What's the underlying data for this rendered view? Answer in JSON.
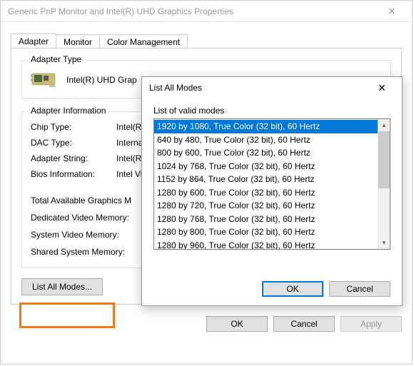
{
  "window": {
    "title": "Generic PnP Monitor and Intel(R) UHD Graphics Properties",
    "tabs": [
      "Adapter",
      "Monitor",
      "Color Management"
    ],
    "active_tab": 0
  },
  "adapter_type": {
    "group_label": "Adapter Type",
    "value": "Intel(R) UHD Grap"
  },
  "adapter_info": {
    "group_label": "Adapter Information",
    "rows": [
      {
        "label": "Chip Type:",
        "value": "Intel(R)"
      },
      {
        "label": "DAC Type:",
        "value": "Internal"
      },
      {
        "label": "Adapter String:",
        "value": "Intel(R)"
      },
      {
        "label": "Bios Information:",
        "value": "Intel Vid"
      }
    ],
    "totals": [
      {
        "label": "Total Available Graphics M"
      },
      {
        "label": "Dedicated Video Memory:"
      },
      {
        "label": "System Video Memory:"
      },
      {
        "label": "Shared System Memory:"
      }
    ]
  },
  "buttons": {
    "list_all_modes": "List All Modes...",
    "ok": "OK",
    "cancel": "Cancel",
    "apply": "Apply"
  },
  "dialog": {
    "title": "List All Modes",
    "list_label": "List of valid modes",
    "modes": [
      "1920 by 1080, True Color (32 bit), 60 Hertz",
      "640 by 480, True Color (32 bit), 60 Hertz",
      "800 by 600, True Color (32 bit), 60 Hertz",
      "1024 by 768, True Color (32 bit), 60 Hertz",
      "1152 by 864, True Color (32 bit), 60 Hertz",
      "1280 by 600, True Color (32 bit), 60 Hertz",
      "1280 by 720, True Color (32 bit), 60 Hertz",
      "1280 by 768, True Color (32 bit), 60 Hertz",
      "1280 by 800, True Color (32 bit), 60 Hertz",
      "1280 by 960, True Color (32 bit), 60 Hertz"
    ],
    "selected_index": 0,
    "ok": "OK",
    "cancel": "Cancel"
  }
}
